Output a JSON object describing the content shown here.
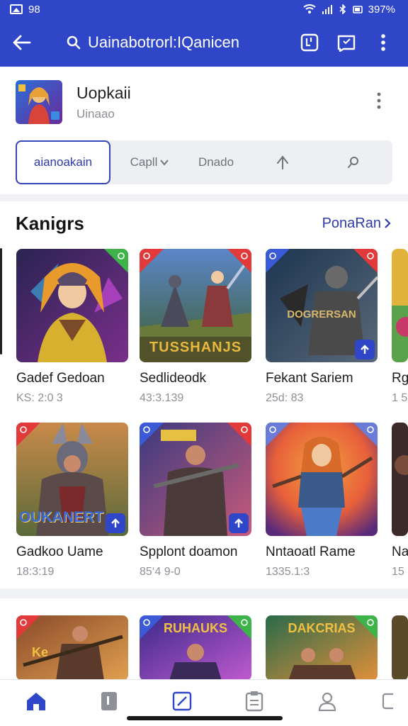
{
  "status_bar": {
    "left_text": "98",
    "right_text": "397%"
  },
  "search": {
    "query": "Uainabotrorl:IQanicen"
  },
  "app_header": {
    "name": "Uopkaii",
    "subtitle": "Uinaao"
  },
  "tabs": [
    {
      "label": "aianoakain",
      "active": true
    },
    {
      "label": "Capll",
      "active": false
    },
    {
      "label": "Dnado",
      "active": false
    }
  ],
  "section": {
    "title": "Kanigrs",
    "link_label": "PonaRan"
  },
  "games": [
    {
      "name": "Gadef Gedoan",
      "meta": "KS: 2:0 3",
      "badge_color": "#3eb34a",
      "bg1": "#2a2352",
      "bg2": "#7a2f8a",
      "accent": "#f2b43c"
    },
    {
      "name": "Sedlideodk",
      "meta": "43:3.139",
      "badge_color": "#e23a3a",
      "bg1": "#5b86c9",
      "bg2": "#3d5e2e",
      "accent": "#e0a83a",
      "art_title": "TUSSHANJS"
    },
    {
      "name": "Fekant Sariem",
      "meta": "25d: 83",
      "badge_color": "#e23a3a",
      "bg1": "#1d3550",
      "bg2": "#59697a",
      "accent": "#b9a070",
      "art_title": "DOGRERSAN"
    },
    {
      "name": "Rg",
      "meta": "1 5",
      "badge_color": "#e2a23a",
      "bg1": "#e2b33a",
      "bg2": "#5aa34a",
      "accent": "#ffffff"
    },
    {
      "name": "Gadkoo Uame",
      "meta": "18:3:19",
      "badge_color": "#e23a3a",
      "bg1": "#8a5a3a",
      "bg2": "#c98a4a",
      "accent": "#c8a83a",
      "art_title": "OUKANERT"
    },
    {
      "name": "Spplont doamon",
      "meta": "85‘4 9-0",
      "badge_color": "#e23a3a",
      "bg1": "#3a3a80",
      "bg2": "#c85a7a",
      "accent": "#e6c040"
    },
    {
      "name": "Nntaoatl Rame",
      "meta": "1335.1:3",
      "badge_color": "#6a7cd8",
      "bg1": "#e8603a",
      "bg2": "#5a2a7a",
      "accent": "#f2c080"
    },
    {
      "name": "Na",
      "meta": "15",
      "badge_color": "#e2a23a",
      "bg1": "#3a2a2a",
      "bg2": "#7a4a3a",
      "accent": "#e0c080"
    }
  ],
  "second_row": [
    {
      "badge_color": "#e23a3a",
      "bg1": "#8a4a2a",
      "bg2": "#e0a050",
      "accent": "#f2c040",
      "art_title": ""
    },
    {
      "badge_color": "#3eb34a",
      "bg1": "#3a2a8a",
      "bg2": "#c05ad0",
      "accent": "#f2c040",
      "art_title": "RUHAUKS"
    },
    {
      "badge_color": "#3eb34a",
      "bg1": "#2a6a4a",
      "bg2": "#e0903a",
      "accent": "#f2c040",
      "art_title": "DAKCRIAS"
    }
  ]
}
